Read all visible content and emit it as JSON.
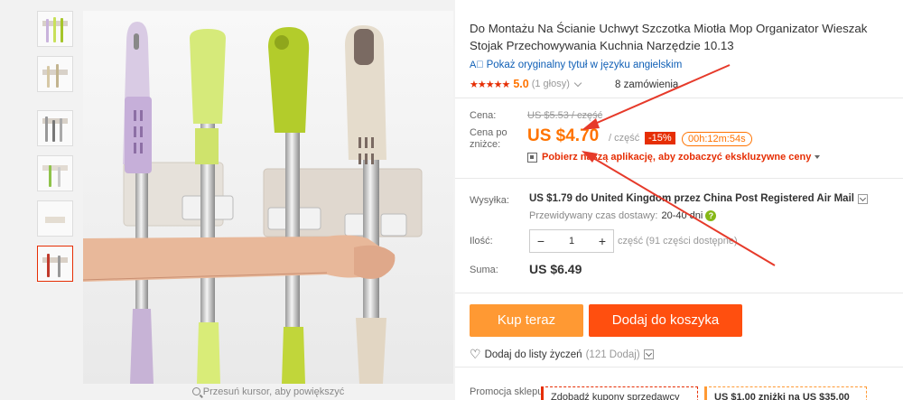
{
  "product": {
    "title": "Do Montażu Na Ścianie Uchwyt Szczotka Miotła Mop Organizator Wieszak Stojak Przechowywania Kuchnia Narzędzie 10.13",
    "original_title_link": "Pokaż oryginalny tytuł w języku angielskim",
    "translate_icon": "translate-icon",
    "rating": "5.0",
    "votes": "(1 głosy)",
    "orders": "8 zamówienia",
    "stars": "★★★★★"
  },
  "price": {
    "label": "Cena:",
    "old": "US $5.53 / część",
    "discount_label": "Cena po zniżce:",
    "current": "US $4.70",
    "per": "/ część",
    "discount": "-15%",
    "timer": "00h:12m:54s",
    "app_promo": "Pobierz naszą aplikację, aby zobaczyć ekskluzywne ceny"
  },
  "shipping": {
    "label": "Wysyłka:",
    "text": "US $1.79 do United Kingdom przez China Post Registered Air Mail",
    "delivery_label": "Przewidywany czas dostawy:",
    "delivery_days": "20-40 dni",
    "help_icon": "?"
  },
  "quantity": {
    "label": "Ilość:",
    "minus": "−",
    "value": "1",
    "plus": "+",
    "note": "część (91 części dostępne)"
  },
  "total": {
    "label": "Suma:",
    "value": "US $6.49"
  },
  "actions": {
    "buy": "Kup teraz",
    "cart": "Dodaj do koszyka",
    "wishlist": "Dodaj do listy życzeń",
    "wishlist_count": "(121 Dodaj)"
  },
  "promo": {
    "label": "Promocja sklepu",
    "coupon1": "Zdobądź kupony sprzedawcy",
    "coupon2": "US $1.00 zniżki na US $35.00"
  },
  "gallery": {
    "zoom_hint": "Przesuń kursor, aby powiększyć"
  },
  "colors": {
    "accent": "#ff7300",
    "red": "#e62e04",
    "buy": "#ff9933",
    "cart": "#ff4f0f"
  }
}
